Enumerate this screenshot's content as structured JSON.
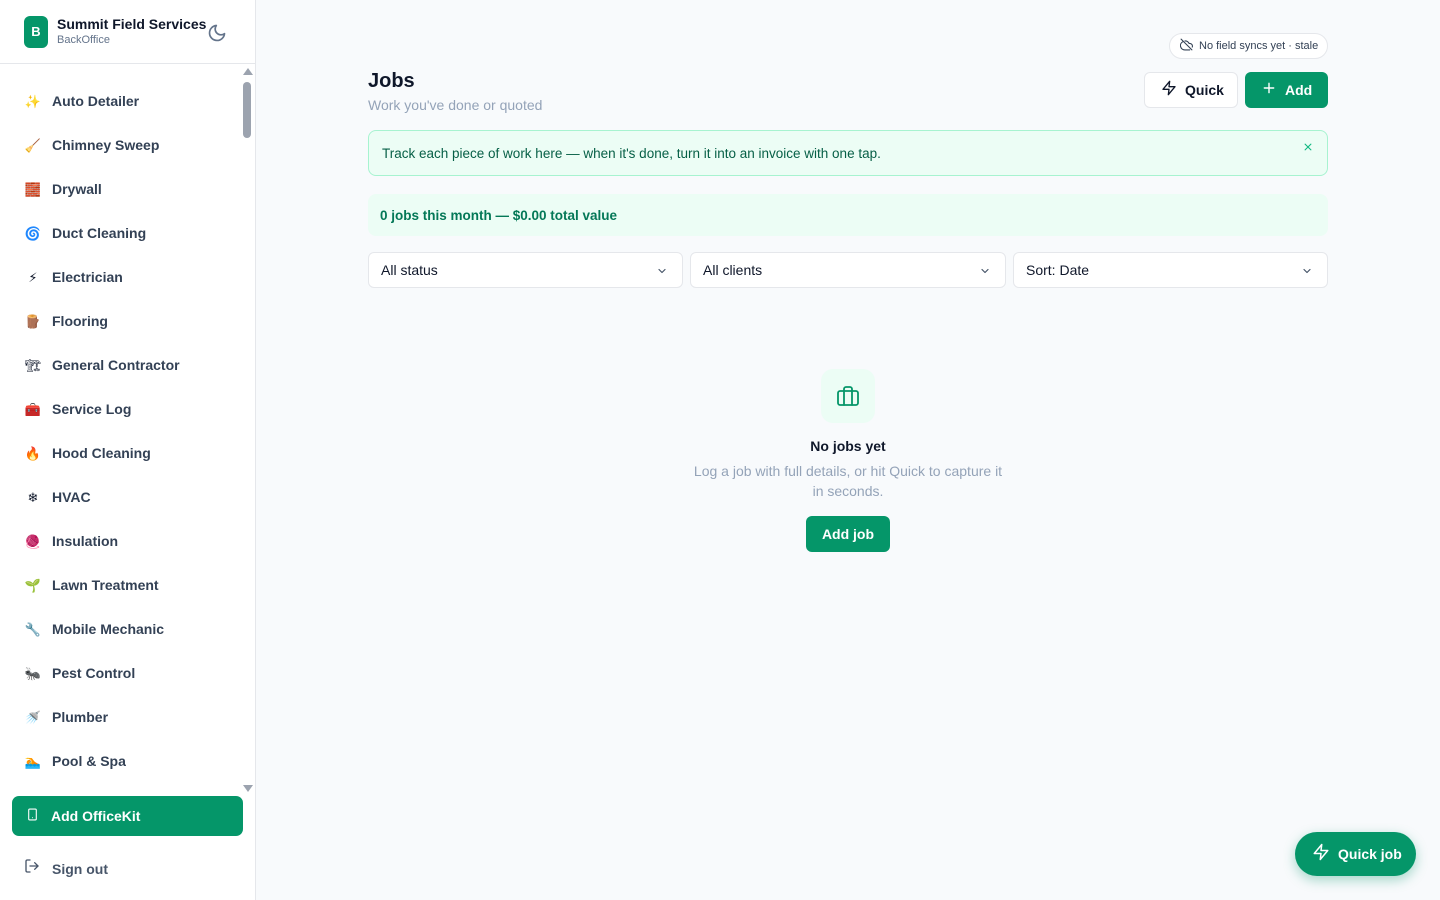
{
  "brand": {
    "initial": "B",
    "name": "Summit Field Services",
    "sub": "BackOffice"
  },
  "sidebar": {
    "items": [
      {
        "label": "Auto Detailer",
        "icon": "sparkles-icon",
        "glyph": "✨"
      },
      {
        "label": "Chimney Sweep",
        "icon": "broom-icon",
        "glyph": "🧹"
      },
      {
        "label": "Drywall",
        "icon": "brick-icon",
        "glyph": "🧱"
      },
      {
        "label": "Duct Cleaning",
        "icon": "cyclone-icon",
        "glyph": "🌀"
      },
      {
        "label": "Electrician",
        "icon": "lightning-icon",
        "glyph": "⚡"
      },
      {
        "label": "Flooring",
        "icon": "wood-icon",
        "glyph": "🪵"
      },
      {
        "label": "General Contractor",
        "icon": "construction-icon",
        "glyph": "🏗"
      },
      {
        "label": "Service Log",
        "icon": "toolbox-icon",
        "glyph": "🧰"
      },
      {
        "label": "Hood Cleaning",
        "icon": "fire-icon",
        "glyph": "🔥"
      },
      {
        "label": "HVAC",
        "icon": "snowflake-icon",
        "glyph": "❄"
      },
      {
        "label": "Insulation",
        "icon": "fiber-icon",
        "glyph": "🧶"
      },
      {
        "label": "Lawn Treatment",
        "icon": "seedling-icon",
        "glyph": "🌱"
      },
      {
        "label": "Mobile Mechanic",
        "icon": "wrench-icon",
        "glyph": "🔧"
      },
      {
        "label": "Pest Control",
        "icon": "ant-icon",
        "glyph": "🐜"
      },
      {
        "label": "Plumber",
        "icon": "faucet-icon",
        "glyph": "🚿"
      },
      {
        "label": "Pool & Spa",
        "icon": "swimmer-icon",
        "glyph": "🏊"
      }
    ],
    "officekit_label": "Add OfficeKit",
    "signout_label": "Sign out"
  },
  "sync_status": "No field syncs yet · stale",
  "header": {
    "title": "Jobs",
    "subtitle": "Work you've done or quoted",
    "quick_label": "Quick",
    "add_label": "Add"
  },
  "tip": "Track each piece of work here — when it's done, turn it into an invoice with one tap.",
  "summary": "0 jobs this month — $0.00 total value",
  "filters": {
    "status": "All status",
    "clients": "All clients",
    "sort": "Sort: Date"
  },
  "empty": {
    "title": "No jobs yet",
    "description": "Log a job with full details, or hit Quick to capture it in seconds.",
    "button_label": "Add job"
  },
  "fab_label": "Quick job",
  "colors": {
    "accent": "#059669",
    "accent_light": "#ecfdf5",
    "text": "#0f172a",
    "muted": "#94a3b8"
  }
}
